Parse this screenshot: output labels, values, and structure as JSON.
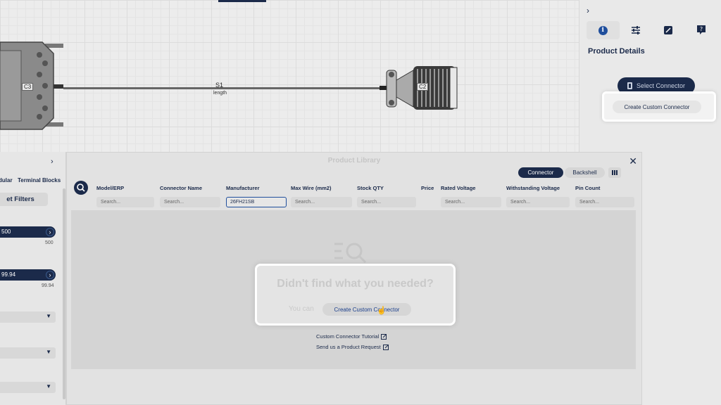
{
  "canvas": {
    "cable": {
      "label": "S1",
      "sublabel": "length"
    },
    "connectors": [
      {
        "label": "C3"
      },
      {
        "label": "C2"
      }
    ]
  },
  "right_panel": {
    "collapse_icon": "chevron-right-icon",
    "tabs": [
      {
        "icon": "info-icon",
        "active": true
      },
      {
        "icon": "sliders-icon",
        "active": false
      },
      {
        "icon": "edit-icon",
        "active": false
      },
      {
        "icon": "help-icon",
        "active": false
      }
    ],
    "title": "Product Details",
    "select_connector_label": "Select Connector",
    "create_custom_label": "Create Custom Connector"
  },
  "library": {
    "title": "Product Library",
    "toggle": {
      "active": "Connector",
      "inactive": "Backshell"
    },
    "columns": [
      {
        "header": "Model/ERP",
        "placeholder": "Search..."
      },
      {
        "header": "Connector Name",
        "placeholder": "Search..."
      },
      {
        "header": "Manufacturer",
        "value": "26FH21SB"
      },
      {
        "header": "Max Wire (mm2)",
        "placeholder": "Search..."
      },
      {
        "header": "Stock QTY",
        "placeholder": "Search..."
      },
      {
        "header": "Price"
      },
      {
        "header": "Rated Voltage",
        "placeholder": "Search..."
      },
      {
        "header": "Withstanding Voltage",
        "placeholder": "Search..."
      },
      {
        "header": "Pin Count",
        "placeholder": "Search..."
      }
    ],
    "empty_state": {
      "title": "Didn't find what you needed?",
      "prefix": "You can",
      "button": "Create Custom Connector",
      "links": [
        "Custom Connector Tutorial",
        "Send us a Product Request"
      ]
    }
  },
  "filters": {
    "tabs": [
      "dular",
      "Terminal Blocks"
    ],
    "reset_label": "et Filters",
    "sliders": [
      {
        "value": "500",
        "max_label": "500"
      },
      {
        "value": "99.94",
        "max_label": "99.94"
      }
    ]
  },
  "colors": {
    "primary": "#1b2a4a",
    "accent": "#1f4e9c"
  }
}
